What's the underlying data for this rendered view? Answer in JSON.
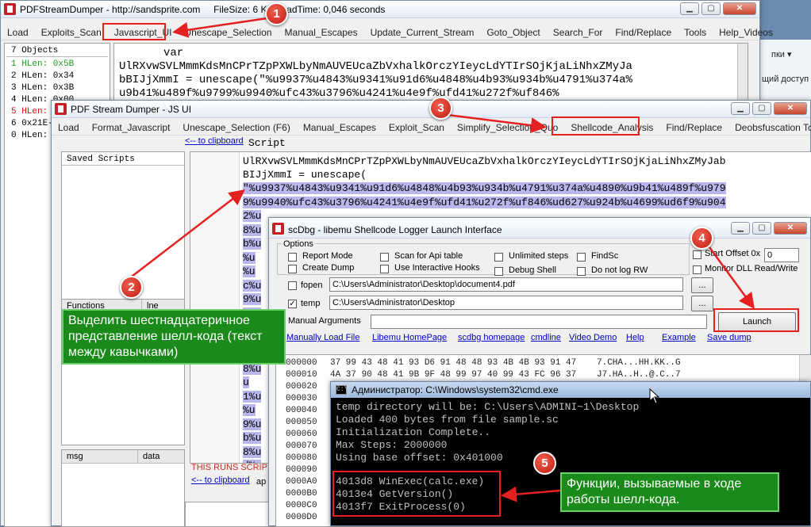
{
  "main_window": {
    "title": "PDFStreamDumper - http://sandsprite.com",
    "title_info": "FileSize: 6 KB  LoadTime: 0,046 seconds",
    "menu": [
      "Load",
      "Exploits_Scan",
      "Javascript_UI",
      "Unescape_Selection",
      "Manual_Escapes",
      "Update_Current_Stream",
      "Goto_Object",
      "Search_For",
      "Find/Replace",
      "Tools",
      "Help_Videos"
    ],
    "objects_header": "7 Objects",
    "objects": [
      {
        "text": "1 HLen: 0x5B",
        "color": "#1a9a1a"
      },
      {
        "text": "2 HLen: 0x34",
        "color": "#000000"
      },
      {
        "text": "3 HLen: 0x3B",
        "color": "#000000"
      },
      {
        "text": "4 HLen: 0x00",
        "color": "#000000"
      },
      {
        "text": "5 HLen: 0x00",
        "color": "#d01010"
      },
      {
        "text": "6 0x21E-",
        "color": "#000000"
      },
      {
        "text": "0 HLen: 0x",
        "color": "#000000"
      }
    ],
    "code_lines": [
      "var",
      "UlRXvwSVLMmmKdsMnCPrTZpPXWLbyNmAUVEUcaZbVxhalkOrczYIeycLdYTIrSOjKjaLiNhxZMyJa",
      "bBIJjXmmI = unescape(\"%u9937%u4843%u9341%u91d6%u4848%u4b93%u934b%u4791%u374a%",
      "u9b41%u489f%u9799%u9940%ufc43%u3796%u4241%u4e9f%ufd41%u272f%uf846%"
    ]
  },
  "bg_window": {
    "left_text": "пки ▾",
    "right_text": "щий доступ"
  },
  "js_window": {
    "title": "PDF Stream Dumper - JS UI",
    "menu": [
      "Load",
      "Format_Javascript",
      "Unescape_Selection (F6)",
      "Manual_Escapes",
      "Exploit_Scan",
      "Simplify_Selection_Quo",
      "Shellcode_Analysis",
      "Find/Replace",
      "Deobsfuscation Tools"
    ],
    "to_clipboard": "<-- to clipboard",
    "script_label": "Script",
    "saved_scripts": "Saved Scripts",
    "functions_col": "Functions",
    "line_col": "lne",
    "msg_col": "msg",
    "data_col": "data",
    "runs_warning": "THIS RUNS SCRIP",
    "to_clipboard2": "<-- to clipboard",
    "ap_text": "ap",
    "code_lines": [
      "UlRXvwSVLMmmKdsMnCPrTZpPXWLbyNmAUVEUcaZbVxhalkOrczYIeycLdYTIrSOjKjaLiNhxZMyJab",
      "BIJjXmmI = unescape("
    ],
    "sel_line1": "\"%u9937%u4843%u9341%u91d6%u4848%u4b93%u934b%u4791%u374a%u4890%u9b41%u489f%u979",
    "sel_line2": "9%u9940%ufc43%u3796%u4241%u4e9f%ufd41%u272f%uf846%ud627%u924b%u4699%ud6f9%u904",
    "sel_line3": "2%u",
    "sel_rest": [
      "8%u",
      "b%u",
      "%u",
      "%u",
      "c%u",
      "9%u",
      "4%u",
      "u",
      "b%u",
      "0%u",
      "8%u",
      "u",
      "1%u",
      "%u",
      "9%u",
      "b%u",
      "8%u",
      "d%u",
      "5%u"
    ]
  },
  "scdbg": {
    "title": "scDbg - libemu Shellcode Logger Launch Interface",
    "options_label": "Options",
    "opts": [
      {
        "label": "Report Mode",
        "checked": false
      },
      {
        "label": "Create Dump",
        "checked": false
      },
      {
        "label": "Scan for Api table",
        "checked": false
      },
      {
        "label": "Use Interactive Hooks",
        "checked": false
      },
      {
        "label": "Unlimited steps",
        "checked": false
      },
      {
        "label": "Debug Shell",
        "checked": false
      },
      {
        "label": "FindSc",
        "checked": false
      },
      {
        "label": "Do not log RW",
        "checked": false
      }
    ],
    "start_offset_label": "Start Offset  0x",
    "start_offset_value": "0",
    "monitor_dll": "Monitor DLL Read/Write",
    "fopen_label": "fopen",
    "fopen_value": "C:\\Users\\Administrator\\Desktop\\document4.pdf",
    "temp_label": "temp",
    "temp_value": "C:\\Users\\Administrator\\Desktop",
    "browse": "...",
    "manual_args": "Manual Arguments",
    "launch": "Launch",
    "links": [
      "Manually Load File",
      "Libemu HomePage",
      "scdbg homepage",
      "cmdline",
      "Video Demo",
      "Help",
      "Example",
      "Save dump"
    ],
    "hex_rows": [
      {
        "off": "000000",
        "bytes": "37 99 43 48 41 93 D6 91 48 48 93 4B 4B 93 91 47",
        "ascii": "7.CHA...HH.KK..G"
      },
      {
        "off": "000010",
        "bytes": "4A 37 90 48 41 9B 9F 48 99 97 40 99 43 FC 96 37",
        "ascii": "J7.HA..H..@.C..7"
      },
      {
        "off": "000020",
        "bytes": "",
        "ascii": ""
      },
      {
        "off": "000030",
        "bytes": "",
        "ascii": ""
      },
      {
        "off": "000040",
        "bytes": "",
        "ascii": ""
      },
      {
        "off": "000050",
        "bytes": "",
        "ascii": ""
      },
      {
        "off": "000060",
        "bytes": "",
        "ascii": ""
      },
      {
        "off": "000070",
        "bytes": "",
        "ascii": ""
      },
      {
        "off": "000080",
        "bytes": "",
        "ascii": ""
      },
      {
        "off": "000090",
        "bytes": "",
        "ascii": ""
      },
      {
        "off": "0000A0",
        "bytes": "",
        "ascii": ""
      },
      {
        "off": "0000B0",
        "bytes": "",
        "ascii": ""
      },
      {
        "off": "0000C0",
        "bytes": "",
        "ascii": ""
      },
      {
        "off": "0000D0",
        "bytes": "",
        "ascii": ""
      }
    ]
  },
  "cmd": {
    "title": "Администратор: C:\\Windows\\system32\\cmd.exe",
    "lines": [
      "temp directory will be: C:\\Users\\ADMINI~1\\Desktop",
      "Loaded 400 bytes from file sample.sc",
      "Initialization Complete..",
      "Max Steps: 2000000",
      "Using base offset: 0x401000"
    ],
    "calls": [
      "4013d8  WinExec(calc.exe)",
      "4013e4  GetVersion()",
      "4013f7  ExitProcess(0)"
    ]
  },
  "annotations": {
    "n1": "1",
    "n2": "2",
    "n3": "3",
    "n4": "4",
    "n5": "5",
    "note2": "Выделить шестнадцатеричное представление шелл-кода (текст между кавычками)",
    "note5": "Функции, вызываемые в ходе работы шелл-кода.",
    "red": "#e52020",
    "green": "#1a8a1a"
  }
}
